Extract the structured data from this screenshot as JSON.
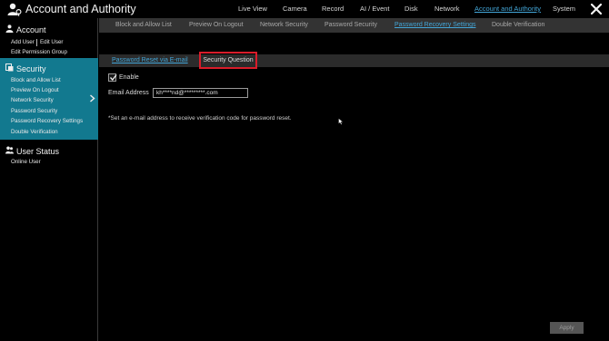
{
  "app": {
    "title": "Account and Authority"
  },
  "top_nav": [
    {
      "label": "Live View",
      "active": false
    },
    {
      "label": "Camera",
      "active": false
    },
    {
      "label": "Record",
      "active": false
    },
    {
      "label": "AI / Event",
      "active": false
    },
    {
      "label": "Disk",
      "active": false
    },
    {
      "label": "Network",
      "active": false
    },
    {
      "label": "Account and Authority",
      "active": true
    },
    {
      "label": "System",
      "active": false
    }
  ],
  "sidebar": {
    "account": {
      "title": "Account",
      "items": [
        "Add User",
        "Edit User",
        "Edit Permission Group"
      ]
    },
    "security": {
      "title": "Security",
      "items": [
        "Block and Allow List",
        "Preview On Logout",
        "Network Security",
        "Password Security",
        "Password Recovery Settings",
        "Double Verification"
      ]
    },
    "user_status": {
      "title": "User Status",
      "items": [
        "Online User"
      ]
    }
  },
  "subtabs": [
    {
      "label": "Block and Allow List",
      "active": false
    },
    {
      "label": "Preview On Logout",
      "active": false
    },
    {
      "label": "Network Security",
      "active": false
    },
    {
      "label": "Password Security",
      "active": false
    },
    {
      "label": "Password Recovery Settings",
      "active": true
    },
    {
      "label": "Double Verification",
      "active": false
    }
  ],
  "inner_tabs": {
    "email": "Password Reset via E-mail",
    "security_question": "Security Question"
  },
  "form": {
    "enable_label": "Enable",
    "enabled": true,
    "email_label": "Email Address",
    "email_value": "kh****nd@*********.com",
    "note": "*Set an e-mail address to receive verification code for password reset."
  },
  "apply_label": "Apply",
  "colors": {
    "accent": "#43a6d8",
    "sidebar_active": "#12798f",
    "highlight_box": "#d91c2a"
  }
}
